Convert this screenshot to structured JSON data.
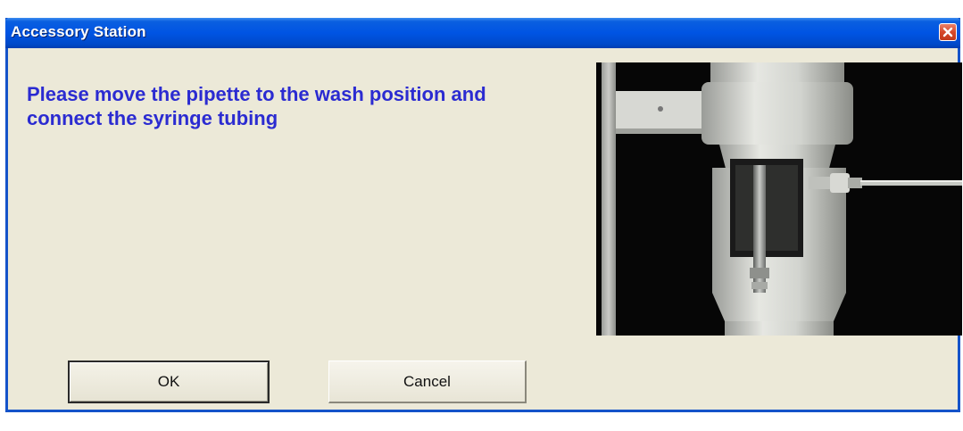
{
  "window": {
    "title": "Accessory Station",
    "close_icon": "close-icon",
    "titlebar_color": "#0054e3",
    "body_color": "#ece9d8"
  },
  "dialog": {
    "message": "Please move the pipette to the wash position and connect the syringe tubing",
    "message_color": "#2b2bd1",
    "image_icon": "pipette-wash-station-photo"
  },
  "buttons": {
    "ok_label": "OK",
    "cancel_label": "Cancel"
  }
}
